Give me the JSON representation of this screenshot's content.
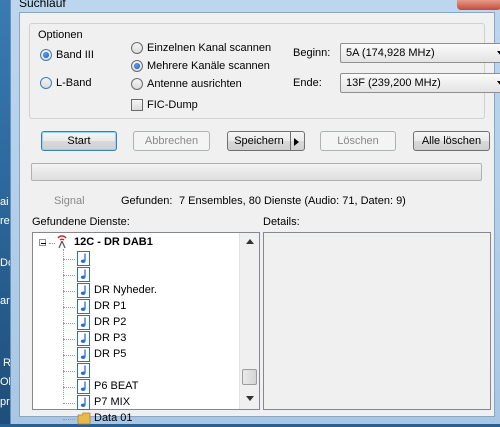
{
  "window": {
    "title": "Suchlauf"
  },
  "desktop_fragments": [
    "ai",
    "re",
    "Do",
    "ar",
    "R",
    "Ol",
    "pre"
  ],
  "options": {
    "legend": "Optionen",
    "band3_label": "Band III",
    "lband_label": "L-Band",
    "scan_single_label": "Einzelnen Kanal scannen",
    "scan_multi_label": "Mehrere Kanäle scannen",
    "antenna_label": "Antenne ausrichten",
    "fic_dump_label": "FIC-Dump",
    "selected_band": "Band III",
    "selected_scan": "Mehrere Kanäle scannen",
    "fic_dump_checked": false
  },
  "range": {
    "begin_label": "Beginn:",
    "begin_value": "5A (174,928 MHz)",
    "end_label": "Ende:",
    "end_value": "13F (239,200 MHz)"
  },
  "buttons": {
    "start": "Start",
    "cancel": "Abbrechen",
    "save": "Speichern",
    "delete": "Löschen",
    "delete_all": "Alle löschen"
  },
  "status": {
    "signal_label": "Signal",
    "found_label": "Gefunden:",
    "found_value": "7 Ensembles, 80 Dienste (Audio: 71, Daten: 9)",
    "progress": 0
  },
  "services": {
    "label": "Gefundene Dienste:",
    "ensemble": "12C - DR DAB1",
    "items": [
      "",
      "",
      "DR Nyheder.",
      "DR P1",
      "DR P2",
      "DR P3",
      "DR P5",
      "",
      "P6 BEAT",
      "P7 MIX",
      "Data 01"
    ]
  },
  "details": {
    "label": "Details:"
  },
  "colors": {
    "accent": "#3c7fb1",
    "note_icon": "#2a6fd6",
    "folder": "#e8b84a"
  }
}
